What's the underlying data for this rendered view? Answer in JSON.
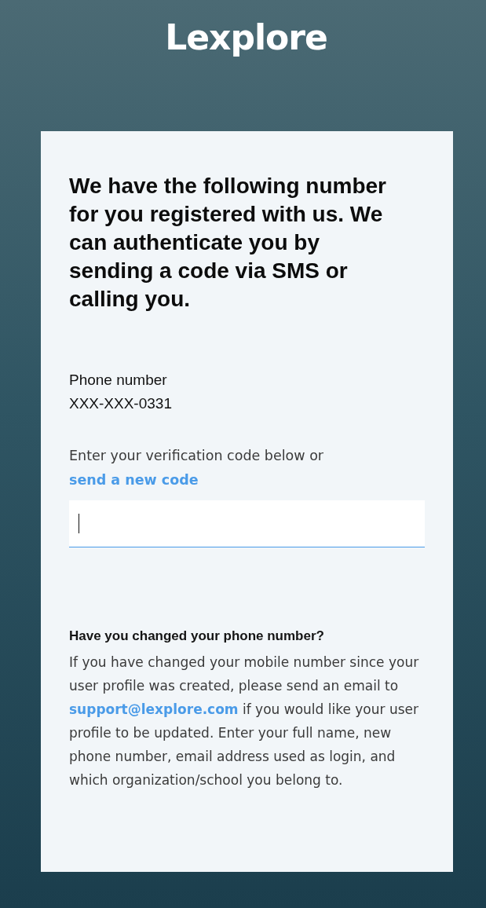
{
  "logo": {
    "text": "Lexplore"
  },
  "card": {
    "heading": "We have the following number for you registered with us. We can authenticate you by sending a code via SMS or calling you.",
    "phone": {
      "label": "Phone number",
      "value": "XXX-XXX-0331"
    },
    "verification": {
      "prompt": "Enter your verification code below or",
      "link": "send a new code",
      "field": {
        "focused": true
      }
    },
    "help": {
      "title": "Have you changed your phone number?",
      "text_before": "If you have changed your mobile number since your user profile was created, please send an email to",
      "email": "support@lexplore.com",
      "text_after": "if you would like your user profile to be updated. Enter your full name, new phone number, email address used as login, and which organization/school you belong to."
    }
  }
}
